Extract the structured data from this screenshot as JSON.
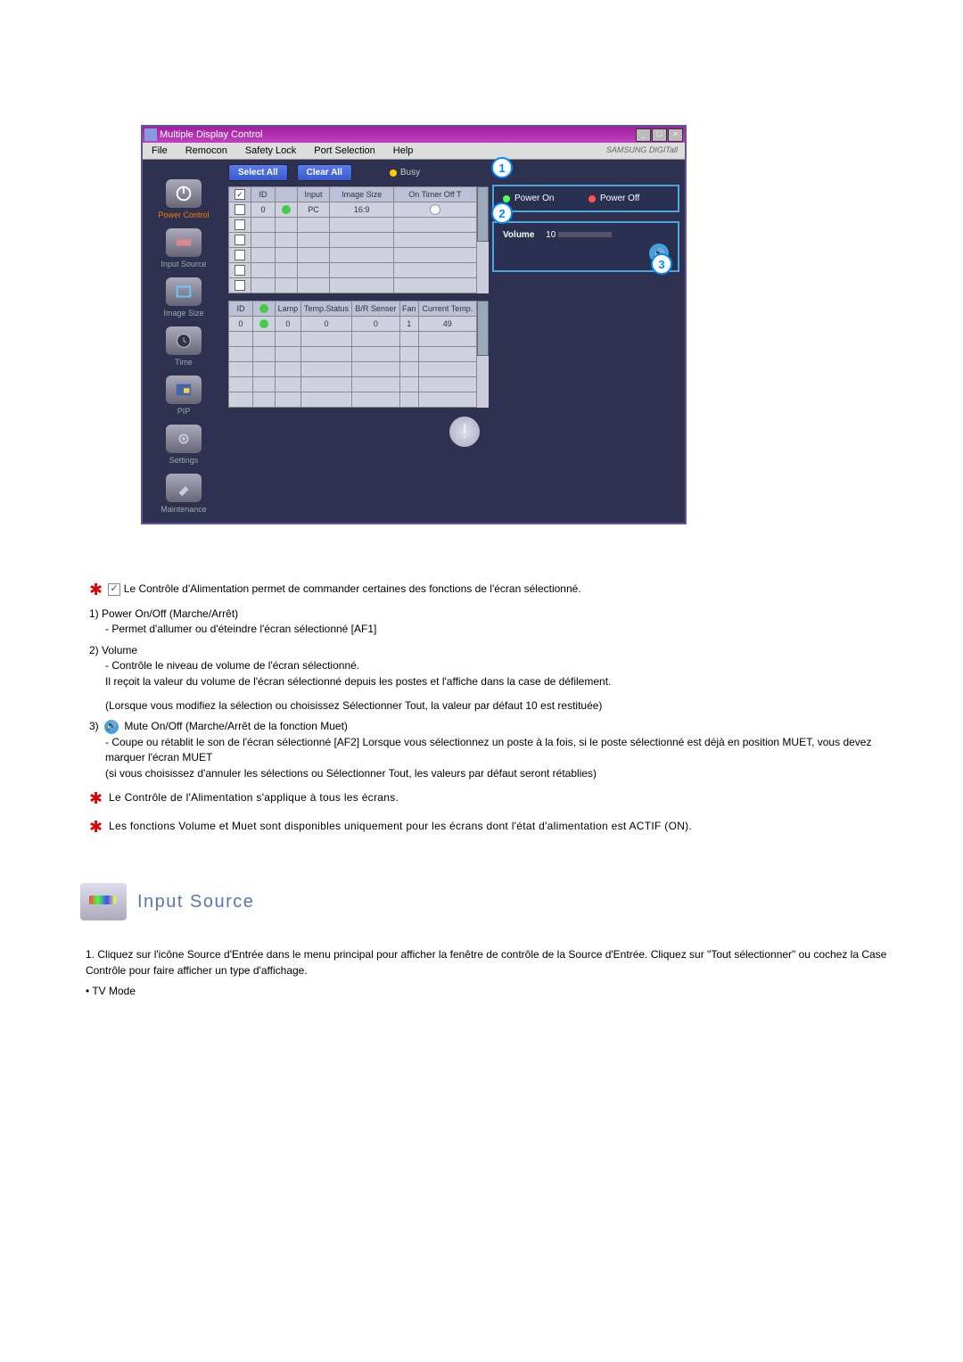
{
  "app": {
    "title": "Multiple Display Control",
    "brand": "SAMSUNG DIGITall"
  },
  "menu": {
    "file": "File",
    "remocon": "Remocon",
    "safety": "Safety Lock",
    "port": "Port Selection",
    "help": "Help"
  },
  "sidebar": {
    "power": "Power Control",
    "input": "Input Source",
    "image": "Image Size",
    "time": "Time",
    "pip": "PIP",
    "settings": "Settings",
    "maint": "Maintenance"
  },
  "buttons": {
    "select_all": "Select All",
    "clear_all": "Clear All",
    "busy": "Busy",
    "power_on": "Power On",
    "power_off": "Power Off"
  },
  "grid1": {
    "h_id": "ID",
    "h_lamp": "",
    "h_input": "Input",
    "h_size": "Image Size",
    "h_timer": "On Timer Off T",
    "r0_id": "0",
    "r0_input": "PC",
    "r0_size": "16:9"
  },
  "grid2": {
    "h_id": "ID",
    "h_l": "",
    "h_lamp": "Lamp",
    "h_temp": "Temp.Status",
    "h_br": "B/R Senser",
    "h_fan": "Fan",
    "h_ct": "Current Temp.",
    "r0_id": "0",
    "r0_lamp": "0",
    "r0_temp": "0",
    "r0_br": "0",
    "r0_fan": "1",
    "r0_ct": "49"
  },
  "vol": {
    "label": "Volume",
    "value": "10"
  },
  "callouts": {
    "c1": "1",
    "c2": "2",
    "c3": "3"
  },
  "text": {
    "intro": "Le Contrôle d'Alimentation permet de commander certaines des fonctions de l'écran sélectionné.",
    "p1_h": "Power On/Off (Marche/Arrêt)",
    "p1_s": "- Permet d'allumer ou d'éteindre l'écran sélectionné [AF1]",
    "p2_h": "Volume",
    "p2_s1": "- Contrôle le niveau de volume de l'écran sélectionné.",
    "p2_s2": "Il reçoit la valeur du volume de l'écran sélectionné depuis les postes et l'affiche dans la case de défilement.",
    "p2_s3": "(Lorsque vous modifiez la sélection ou choisissez Sélectionner Tout, la valeur par défaut 10 est restituée)",
    "p3_h": "Mute On/Off (Marche/Arrêt de la fonction Muet)",
    "p3_s1": "- Coupe ou rétablit le son de l'écran sélectionné [AF2] Lorsque vous sélectionnez un poste à la fois, si le poste sélectionné est déjà en position MUET, vous devez marquer l'écran MUET",
    "p3_s2": "(si vous choisissez d'annuler les sélections ou Sélectionner Tout, les valeurs par défaut seront rétablies)",
    "note1": "Le Contrôle de l'Alimentation s'applique à tous les écrans.",
    "note2": "Les fonctions Volume et Muet sont disponibles uniquement pour les écrans dont l'état d'alimentation est ACTIF (ON).",
    "sec_title": "Input Source",
    "is_1": "Cliquez sur l'icône Source d'Entrée dans le menu principal pour afficher la fenêtre de contrôle de la Source d'Entrée. Cliquez sur \"Tout sélectionner\" ou cochez la Case Contrôle pour faire afficher un type d'affichage.",
    "is_tv": "TV Mode",
    "n1": "1)",
    "n2": "2)",
    "n3": "3)",
    "li1": "1.",
    "bul": "•"
  }
}
